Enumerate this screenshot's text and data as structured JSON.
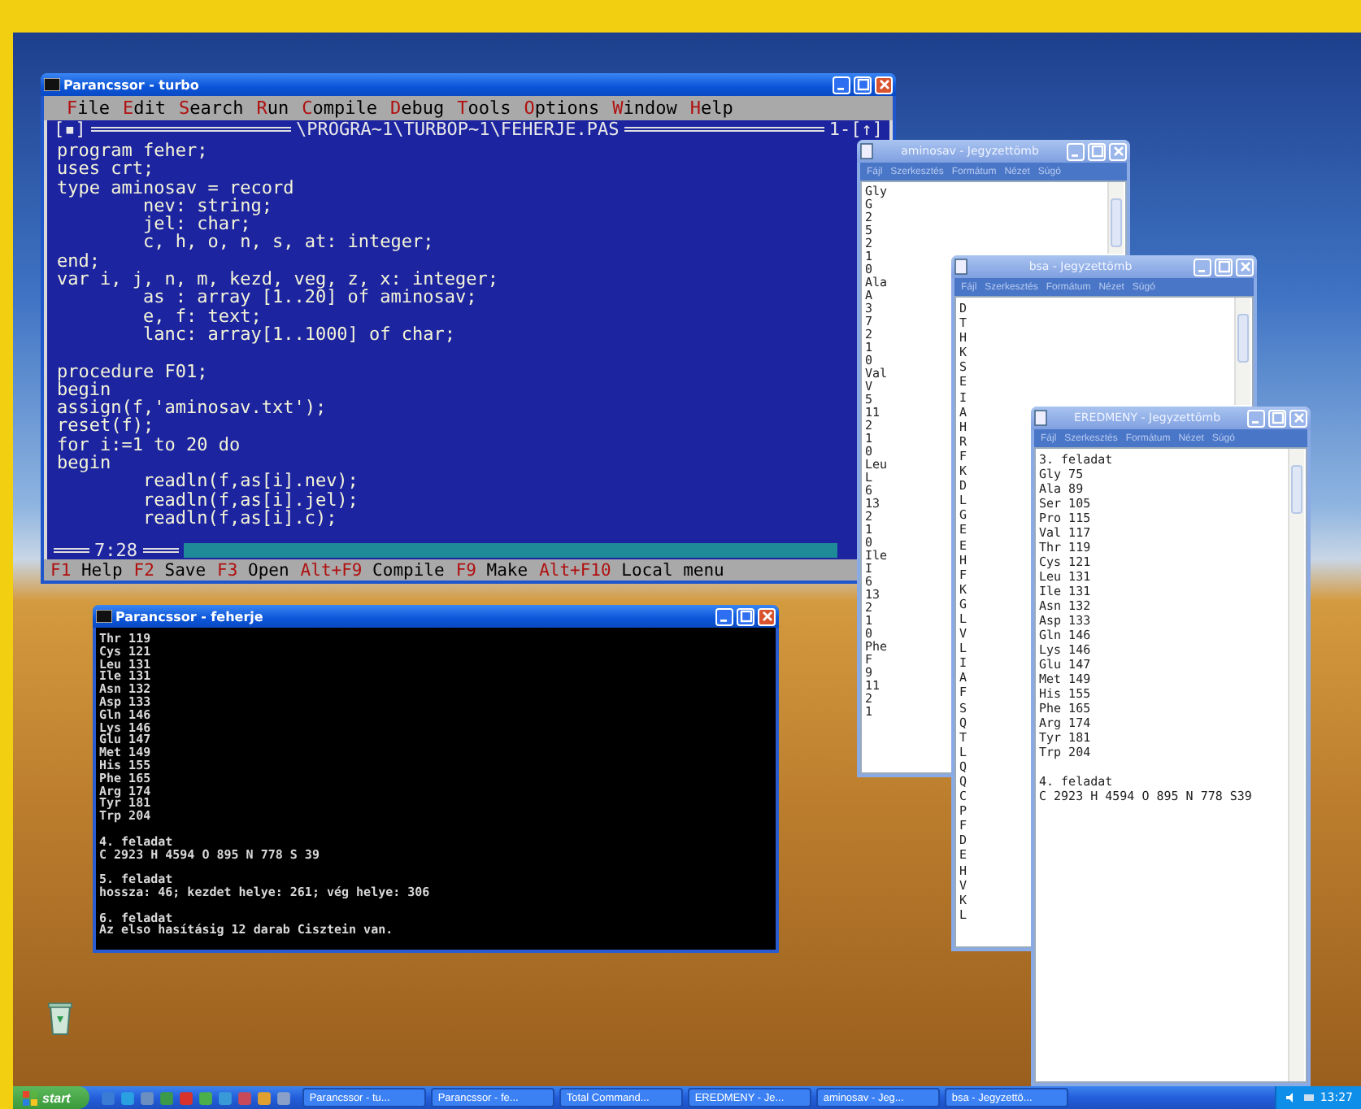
{
  "windows": [
    {
      "kind": "turbo",
      "title": "Parancssor - turbo",
      "menu": [
        "File",
        "Edit",
        "Search",
        "Run",
        "Compile",
        "Debug",
        "Tools",
        "Options",
        "Window",
        "Help"
      ],
      "close_box": "[▪]",
      "file_path": "\\PROGRA~1\\TURBOP~1\\FEHERJE.PAS",
      "window_number": "1-[↑]",
      "cursor_position": "7:28",
      "code_blocks": [
        [
          "program feher;",
          "uses crt;",
          "type aminosav = record",
          "        nev: string;",
          "        jel: char;",
          "        c, h, o, n, s, at: integer;",
          "end;",
          "var i, j, n, m, kezd, veg, z, x: integer;",
          "        as : array [1..20] of aminosav;",
          "        e, f: text;",
          "        lanc: array[1..1000] of char;"
        ],
        [
          "procedure F01;",
          "begin",
          "assign(f,'aminosav.txt');",
          "reset(f);",
          "for i:=1 to 20 do",
          "begin",
          "        readln(f,as[i].nev);",
          "        readln(f,as[i].jel);",
          "        readln(f,as[i].c);"
        ]
      ],
      "shortcuts": [
        {
          "key": "F1",
          "label": "Help"
        },
        {
          "key": "F2",
          "label": "Save"
        },
        {
          "key": "F3",
          "label": "Open"
        },
        {
          "key": "Alt+F9",
          "label": "Compile"
        },
        {
          "key": "F9",
          "label": "Make"
        },
        {
          "key": "Alt+F10",
          "label": "Local menu"
        }
      ]
    },
    {
      "kind": "console",
      "title": "Parancssor - feherje",
      "blocks": [
        [
          "Thr 119",
          "Cys 121",
          "Leu 131",
          "Ile 131",
          "Asn 132",
          "Asp 133",
          "Gln 146",
          "Lys 146",
          "Glu 147",
          "Met 149",
          "His 155",
          "Phe 165",
          "Arg 174",
          "Tyr 181",
          "Trp 204"
        ],
        [
          "4. feladat",
          "C 2923 H 4594 O 895 N 778 S 39"
        ],
        [
          "5. feladat",
          "hossza: 46; kezdet helye: 261; vég helye: 306"
        ],
        [
          "6. feladat",
          "Az elso hasításig 12 darab Cisztein van."
        ]
      ]
    },
    {
      "kind": "notepad",
      "title": "aminosav - Jegyzettömb",
      "menu": [
        "Fájl",
        "Szerkesztés",
        "Formátum",
        "Nézet",
        "Súgó"
      ],
      "blocks": [
        [
          "Gly",
          "G",
          "2",
          "5",
          "2",
          "1",
          "0",
          "Ala",
          "A",
          "3",
          "7",
          "2",
          "1",
          "0",
          "Val",
          "V",
          "5",
          "11",
          "2",
          "1",
          "0",
          "Leu",
          "L",
          "6",
          "13",
          "2",
          "1",
          "0",
          "Ile",
          "I",
          "6",
          "13",
          "2",
          "1",
          "0",
          "Phe",
          "F",
          "9",
          "11",
          "2",
          "1"
        ]
      ]
    },
    {
      "kind": "notepad",
      "title": "bsa - Jegyzettömb",
      "menu": [
        "Fájl",
        "Szerkesztés",
        "Formátum",
        "Nézet",
        "Súgó"
      ],
      "blocks": [
        [
          "D",
          "T",
          "H",
          "K",
          "S",
          "E",
          "I",
          "A",
          "H",
          "R",
          "F",
          "K",
          "D",
          "L",
          "G",
          "E",
          "E",
          "H",
          "F",
          "K",
          "G",
          "L",
          "V",
          "L",
          "I",
          "A",
          "F",
          "S",
          "Q",
          "T",
          "L",
          "Q",
          "Q",
          "C",
          "P",
          "F",
          "D",
          "E",
          "H",
          "V",
          "K",
          "L"
        ]
      ]
    },
    {
      "kind": "notepad",
      "title": "EREDMENY - Jegyzettömb",
      "menu": [
        "Fájl",
        "Szerkesztés",
        "Formátum",
        "Nézet",
        "Súgó"
      ],
      "blocks": [
        [
          "3. feladat",
          "Gly 75",
          "Ala 89",
          "Ser 105",
          "Pro 115",
          "Val 117",
          "Thr 119",
          "Cys 121",
          "Leu 131",
          "Ile 131",
          "Asn 132",
          "Asp 133",
          "Gln 146",
          "Lys 146",
          "Glu 147",
          "Met 149",
          "His 155",
          "Phe 165",
          "Arg 174",
          "Tyr 181",
          "Trp 204"
        ],
        [
          "4. feladat",
          "C 2923 H 4594 O 895 N 778 S39"
        ]
      ]
    }
  ],
  "taskbar": {
    "start": "start",
    "tasks": [
      "Parancssor - tu...",
      "Parancssor - fe...",
      "Total Command...",
      "EREDMENY - Je...",
      "aminosav - Jeg...",
      "bsa - Jegyzettö..."
    ],
    "clock": "13:27"
  }
}
